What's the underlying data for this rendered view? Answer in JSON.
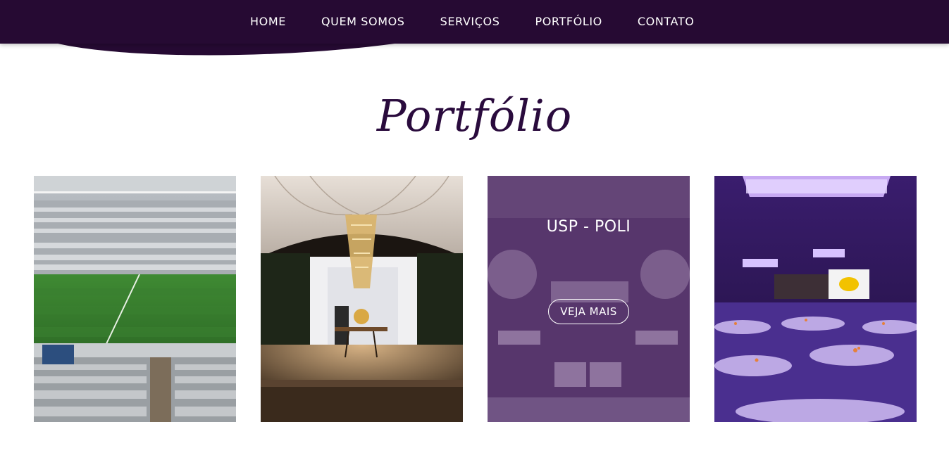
{
  "nav": {
    "items": [
      "HOME",
      "QUEM SOMOS",
      "SERVIÇOS",
      "PORTFÓLIO",
      "CONTATO"
    ]
  },
  "colors": {
    "nav_bg": "#260a33",
    "title": "#2a0b3d",
    "overlay": "#46195f"
  },
  "section": {
    "title": "Portfólio"
  },
  "portfolio": {
    "cards": [
      {
        "image": "stadium-photo"
      },
      {
        "image": "chandelier-stage-photo"
      },
      {
        "image": "purple-lounge-photo",
        "title": "USP - POLI",
        "button": "VEJA MAIS"
      },
      {
        "image": "purple-banquet-hall-photo"
      }
    ]
  }
}
